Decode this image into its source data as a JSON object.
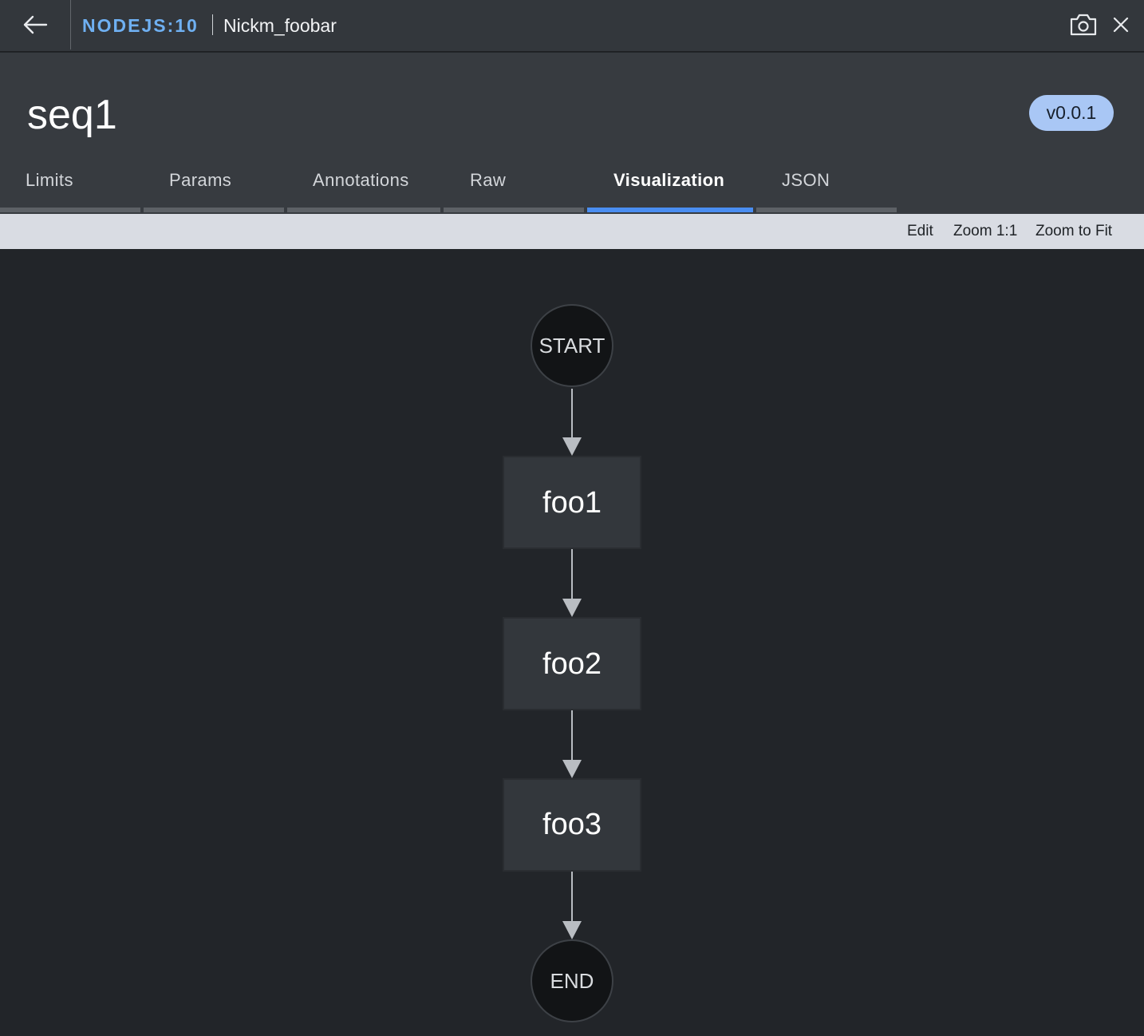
{
  "topbar": {
    "kind": "NODEJS:10",
    "entity": "Nickm_foobar",
    "icons": {
      "back": "arrow-left-icon",
      "camera": "camera-icon",
      "close": "close-icon"
    }
  },
  "header": {
    "title": "seq1",
    "version": "v0.0.1"
  },
  "tabs": [
    {
      "label": "Limits",
      "active": false
    },
    {
      "label": "Params",
      "active": false
    },
    {
      "label": "Annotations",
      "active": false
    },
    {
      "label": "Raw",
      "active": false
    },
    {
      "label": "Visualization",
      "active": true
    },
    {
      "label": "JSON",
      "active": false
    }
  ],
  "toolbar": {
    "edit": "Edit",
    "zoom_1_1": "Zoom 1:1",
    "zoom_fit": "Zoom to Fit"
  },
  "diagram": {
    "start": "START",
    "steps": [
      "foo1",
      "foo2",
      "foo3"
    ],
    "end": "END"
  },
  "colors": {
    "accent": "#4a8ef2",
    "kind_text": "#6fb0f2",
    "version_pill": "#a9c7f5",
    "canvas_bg": "#222529",
    "node_fill": "#33373c",
    "terminal_fill": "#121416"
  }
}
